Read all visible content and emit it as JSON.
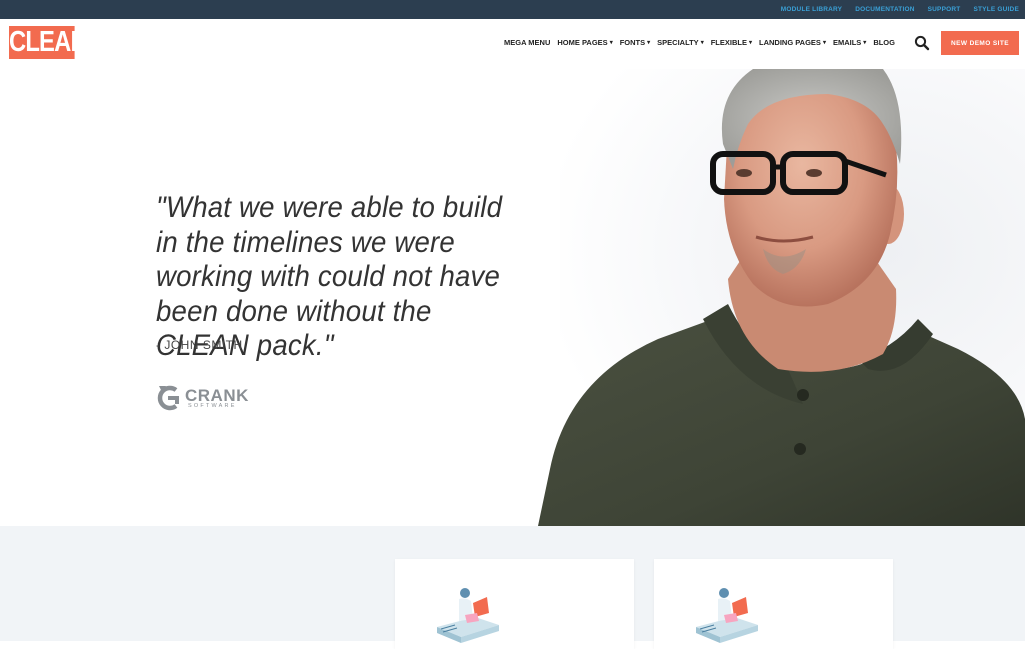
{
  "topbar": {
    "links": [
      "MODULE LIBRARY",
      "DOCUMENTATION",
      "SUPPORT",
      "STYLE GUIDE"
    ]
  },
  "header": {
    "logo_text": "CLEAN",
    "nav": [
      {
        "label": "MEGA MENU",
        "dropdown": false
      },
      {
        "label": "HOME PAGES",
        "dropdown": true
      },
      {
        "label": "FONTS",
        "dropdown": true
      },
      {
        "label": "SPECIALTY",
        "dropdown": true
      },
      {
        "label": "FLEXIBLE",
        "dropdown": true
      },
      {
        "label": "LANDING PAGES",
        "dropdown": true
      },
      {
        "label": "EMAILS",
        "dropdown": true
      },
      {
        "label": "BLOG",
        "dropdown": false
      }
    ],
    "search_icon": "search-icon",
    "cta_label": "NEW DEMO SITE"
  },
  "hero": {
    "quote": "\"What we were able to build in the timelines we were working with could not have been done without the CLEAN pack.\"",
    "author": "- JOHN SMITH",
    "brand": {
      "name": "CRANK",
      "sub": "SOFTWARE"
    }
  },
  "colors": {
    "accent": "#f26b4f",
    "topbar_bg": "#2c3e50",
    "topbar_link": "#3aa0d6",
    "section_bg": "#f1f4f7"
  }
}
